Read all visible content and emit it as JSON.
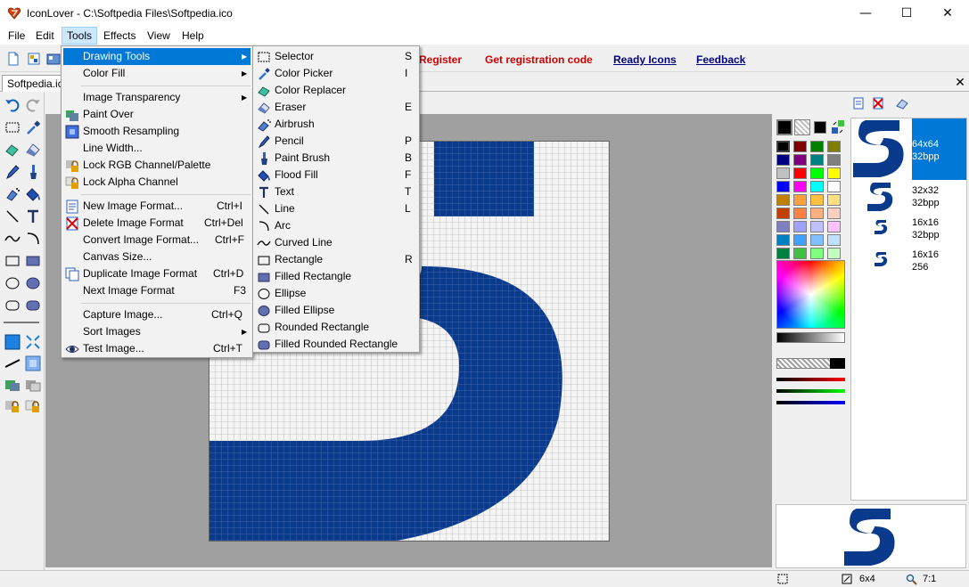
{
  "window": {
    "title": "IconLover - C:\\Softpedia Files\\Softpedia.ico",
    "minimize": "—",
    "maximize": "☐",
    "close": "✕"
  },
  "menubar": {
    "file": "File",
    "edit": "Edit",
    "tools": "Tools",
    "effects": "Effects",
    "view": "View",
    "help": "Help"
  },
  "toolbar": {
    "register": "Register",
    "get_code": "Get registration code",
    "ready_icons": "Ready Icons",
    "feedback": "Feedback"
  },
  "doc_tab": {
    "name": "Softpedia.ico",
    "close": "✕"
  },
  "tools_menu": {
    "drawing_tools": "Drawing Tools",
    "color_fill": "Color Fill",
    "image_transparency": "Image Transparency",
    "paint_over": "Paint Over",
    "smooth_resampling": "Smooth Resampling",
    "line_width": "Line Width...",
    "lock_rgb": "Lock RGB Channel/Palette",
    "lock_alpha": "Lock Alpha Channel",
    "new_format": "New Image Format...",
    "new_format_sc": "Ctrl+I",
    "delete_format": "Delete Image Format",
    "delete_format_sc": "Ctrl+Del",
    "convert_format": "Convert Image Format...",
    "convert_format_sc": "Ctrl+F",
    "canvas_size": "Canvas Size...",
    "duplicate_format": "Duplicate Image Format",
    "duplicate_format_sc": "Ctrl+D",
    "next_format": "Next Image Format",
    "next_format_sc": "F3",
    "capture_image": "Capture Image...",
    "capture_image_sc": "Ctrl+Q",
    "sort_images": "Sort Images",
    "test_image": "Test Image...",
    "test_image_sc": "Ctrl+T"
  },
  "drawing_menu": [
    {
      "label": "Selector",
      "shortcut": "S",
      "icon": "selector-icon"
    },
    {
      "label": "Color Picker",
      "shortcut": "I",
      "icon": "color-picker-icon"
    },
    {
      "label": "Color Replacer",
      "shortcut": "",
      "icon": "color-replacer-icon"
    },
    {
      "label": "Eraser",
      "shortcut": "E",
      "icon": "eraser-icon"
    },
    {
      "label": "Airbrush",
      "shortcut": "",
      "icon": "airbrush-icon"
    },
    {
      "label": "Pencil",
      "shortcut": "P",
      "icon": "pencil-icon"
    },
    {
      "label": "Paint Brush",
      "shortcut": "B",
      "icon": "paint-brush-icon"
    },
    {
      "label": "Flood Fill",
      "shortcut": "F",
      "icon": "flood-fill-icon"
    },
    {
      "label": "Text",
      "shortcut": "T",
      "icon": "text-icon"
    },
    {
      "label": "Line",
      "shortcut": "L",
      "icon": "line-icon"
    },
    {
      "label": "Arc",
      "shortcut": "",
      "icon": "arc-icon"
    },
    {
      "label": "Curved Line",
      "shortcut": "",
      "icon": "curved-line-icon"
    },
    {
      "label": "Rectangle",
      "shortcut": "R",
      "icon": "rectangle-icon"
    },
    {
      "label": "Filled Rectangle",
      "shortcut": "",
      "icon": "filled-rectangle-icon"
    },
    {
      "label": "Ellipse",
      "shortcut": "",
      "icon": "ellipse-icon"
    },
    {
      "label": "Filled Ellipse",
      "shortcut": "",
      "icon": "filled-ellipse-icon"
    },
    {
      "label": "Rounded Rectangle",
      "shortcut": "",
      "icon": "rounded-rectangle-icon"
    },
    {
      "label": "Filled Rounded Rectangle",
      "shortcut": "",
      "icon": "filled-rounded-rectangle-icon"
    }
  ],
  "formats": [
    {
      "size": "64x64",
      "depth": "32bpp"
    },
    {
      "size": "32x32",
      "depth": "32bpp"
    },
    {
      "size": "16x16",
      "depth": "32bpp"
    },
    {
      "size": "16x16",
      "depth": "256"
    }
  ],
  "status": {
    "size": "6x4",
    "zoom": "7:1"
  },
  "colors": {
    "accent": "#0078d7",
    "icon_blue": "#0a3a8c",
    "link_red": "#d00000",
    "link_navy": "#000080",
    "palette": [
      "#000000",
      "#800000",
      "#008000",
      "#808000",
      "#000080",
      "#800080",
      "#008080",
      "#808080",
      "#c0c0c0",
      "#ff0000",
      "#00ff00",
      "#ffff00",
      "#0000ff",
      "#ff00ff",
      "#00ffff",
      "#ffffff",
      "#c08000",
      "#ffa040",
      "#ffc040",
      "#ffe080",
      "#c04000",
      "#ff8040",
      "#ffb080",
      "#ffd0c0",
      "#8080c0",
      "#a0a0ff",
      "#c0c0ff",
      "#ffc0ff",
      "#0080c0",
      "#40a0ff",
      "#80c0ff",
      "#c0e0ff",
      "#008040",
      "#40c040",
      "#80ff80",
      "#c0ffc0"
    ]
  }
}
